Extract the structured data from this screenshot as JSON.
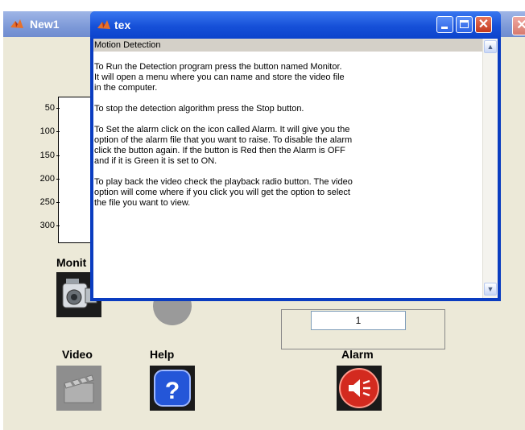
{
  "background_window": {
    "title": "New1",
    "close_glyph": "✕",
    "axes": {
      "yticks": [
        "50",
        "100",
        "150",
        "200",
        "250",
        "300"
      ]
    },
    "frame_edit_value": "1",
    "buttons": [
      {
        "label": "Monit",
        "icon": "camcorder-icon"
      },
      {
        "label": "Video",
        "icon": "clapperboard-icon"
      },
      {
        "label": "Help",
        "icon": "question-icon"
      },
      {
        "label": "Alarm",
        "icon": "speaker-icon"
      }
    ]
  },
  "text_window": {
    "title": "tex",
    "close_glyph": "✕",
    "header": "Motion Detection",
    "paragraphs": [
      [
        "To Run the Detection program press the button named Monitor.",
        "It will open a menu where you can name and store the video file",
        "in the computer."
      ],
      [
        "To stop the detection algorithm press the Stop button."
      ],
      [
        "To Set the alarm click on the icon called Alarm. It will give you the",
        "option of the alarm file that you want to raise. To disable the alarm",
        "click the button again. If the button is Red then the Alarm is OFF",
        "and if it is Green it is set to ON."
      ],
      [
        "To play back the video check the playback radio button. The video",
        "option will come where if you click you will get the option to select",
        "the file you want to view."
      ]
    ],
    "scroll_up": "▲",
    "scroll_down": "▼"
  },
  "colors": {
    "alarm_red": "#d32a1f",
    "help_blue": "#2456d8",
    "titlebar_blue": "#1650d8"
  }
}
